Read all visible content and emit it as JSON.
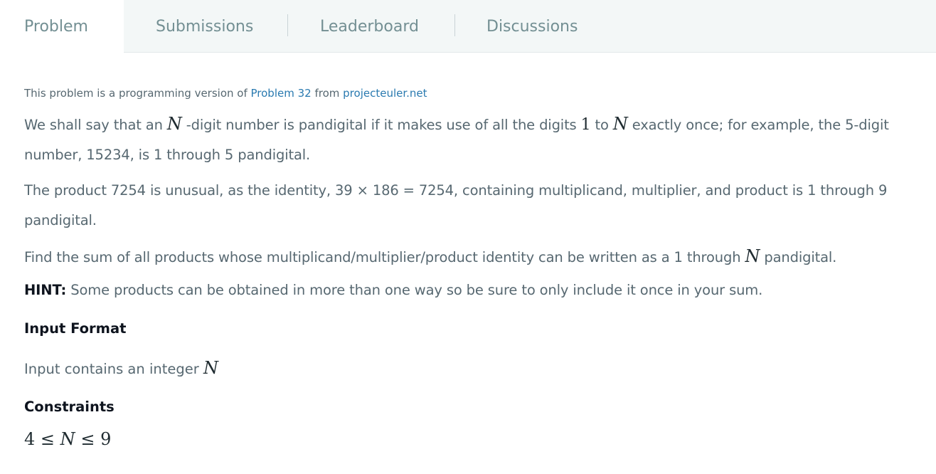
{
  "tabs": [
    {
      "label": "Problem",
      "active": true
    },
    {
      "label": "Submissions",
      "active": false
    },
    {
      "label": "Leaderboard",
      "active": false
    },
    {
      "label": "Discussions",
      "active": false
    }
  ],
  "problem": {
    "source_prefix": "This problem is a programming version of ",
    "source_link": "Problem 32",
    "source_mid": " from ",
    "source_site": "projecteuler.net",
    "p1_a": "We shall say that an ",
    "p1_var": "N",
    "p1_b": " -digit number is pandigital if it makes use of all the digits ",
    "p1_one": "1",
    "p1_c": " to ",
    "p1_var2": "N",
    "p1_d": " exactly once; for example, the 5-digit number, 15234, is 1 through 5 pandigital.",
    "p2": "The product 7254 is unusual, as the identity, 39 × 186 = 7254, containing multiplicand, multiplier, and product is 1 through 9 pandigital.",
    "p3_a": "Find the sum of all products whose multiplicand/multiplier/product identity can be written as a 1 through ",
    "p3_var": "N",
    "p3_b": " pandigital.",
    "hint_label": "HINT:",
    "hint_text": " Some products can be obtained in more than one way so be sure to only include it once in your sum.",
    "input_format_title": "Input Format",
    "input_format_text": "Input contains an integer ",
    "input_format_var": "N",
    "constraints_title": "Constraints",
    "constraint_lo": "4",
    "constraint_le1": "≤",
    "constraint_var": "N",
    "constraint_le2": "≤",
    "constraint_hi": "9"
  },
  "colors": {
    "tabbar_bg": "#f3f7f7",
    "link": "#2a7ab0",
    "body_text": "#576871",
    "heading_text": "#0e141e"
  }
}
